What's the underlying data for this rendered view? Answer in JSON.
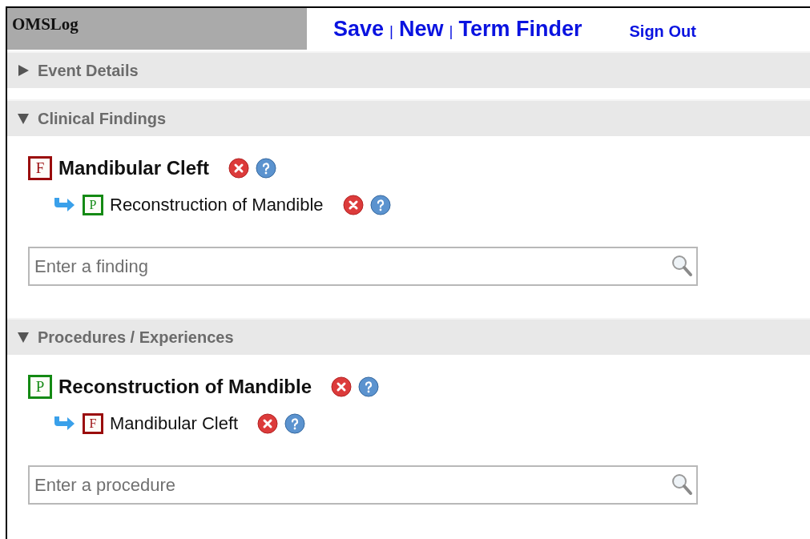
{
  "app_title": "OMSLog",
  "nav": [
    {
      "label": "Save",
      "kind": "link"
    },
    {
      "label": "|",
      "kind": "separator"
    },
    {
      "label": "New",
      "kind": "link"
    },
    {
      "label": "|",
      "kind": "separator"
    },
    {
      "label": "Term Finder",
      "kind": "link"
    },
    {
      "label": "Sign Out",
      "kind": "small-link"
    }
  ],
  "sections": [
    {
      "title": "Event Details",
      "expanded": false
    },
    {
      "title": "Clinical Findings",
      "expanded": true,
      "entries": [
        {
          "kind": "finding",
          "badge": "F",
          "label": "Mandibular Cleft",
          "children": [
            {
              "kind": "procedure",
              "badge": "P",
              "label": "Reconstruction of Mandible"
            }
          ]
        }
      ],
      "search": {
        "placeholder": "Enter a finding"
      }
    },
    {
      "title": "Procedures / Experiences",
      "expanded": true,
      "entries": [
        {
          "kind": "procedure",
          "badge": "P",
          "label": "Reconstruction of Mandible",
          "children": [
            {
              "kind": "finding",
              "badge": "F",
              "label": "Mandibular Cleft"
            }
          ]
        }
      ],
      "search": {
        "placeholder": "Enter a procedure"
      }
    }
  ]
}
